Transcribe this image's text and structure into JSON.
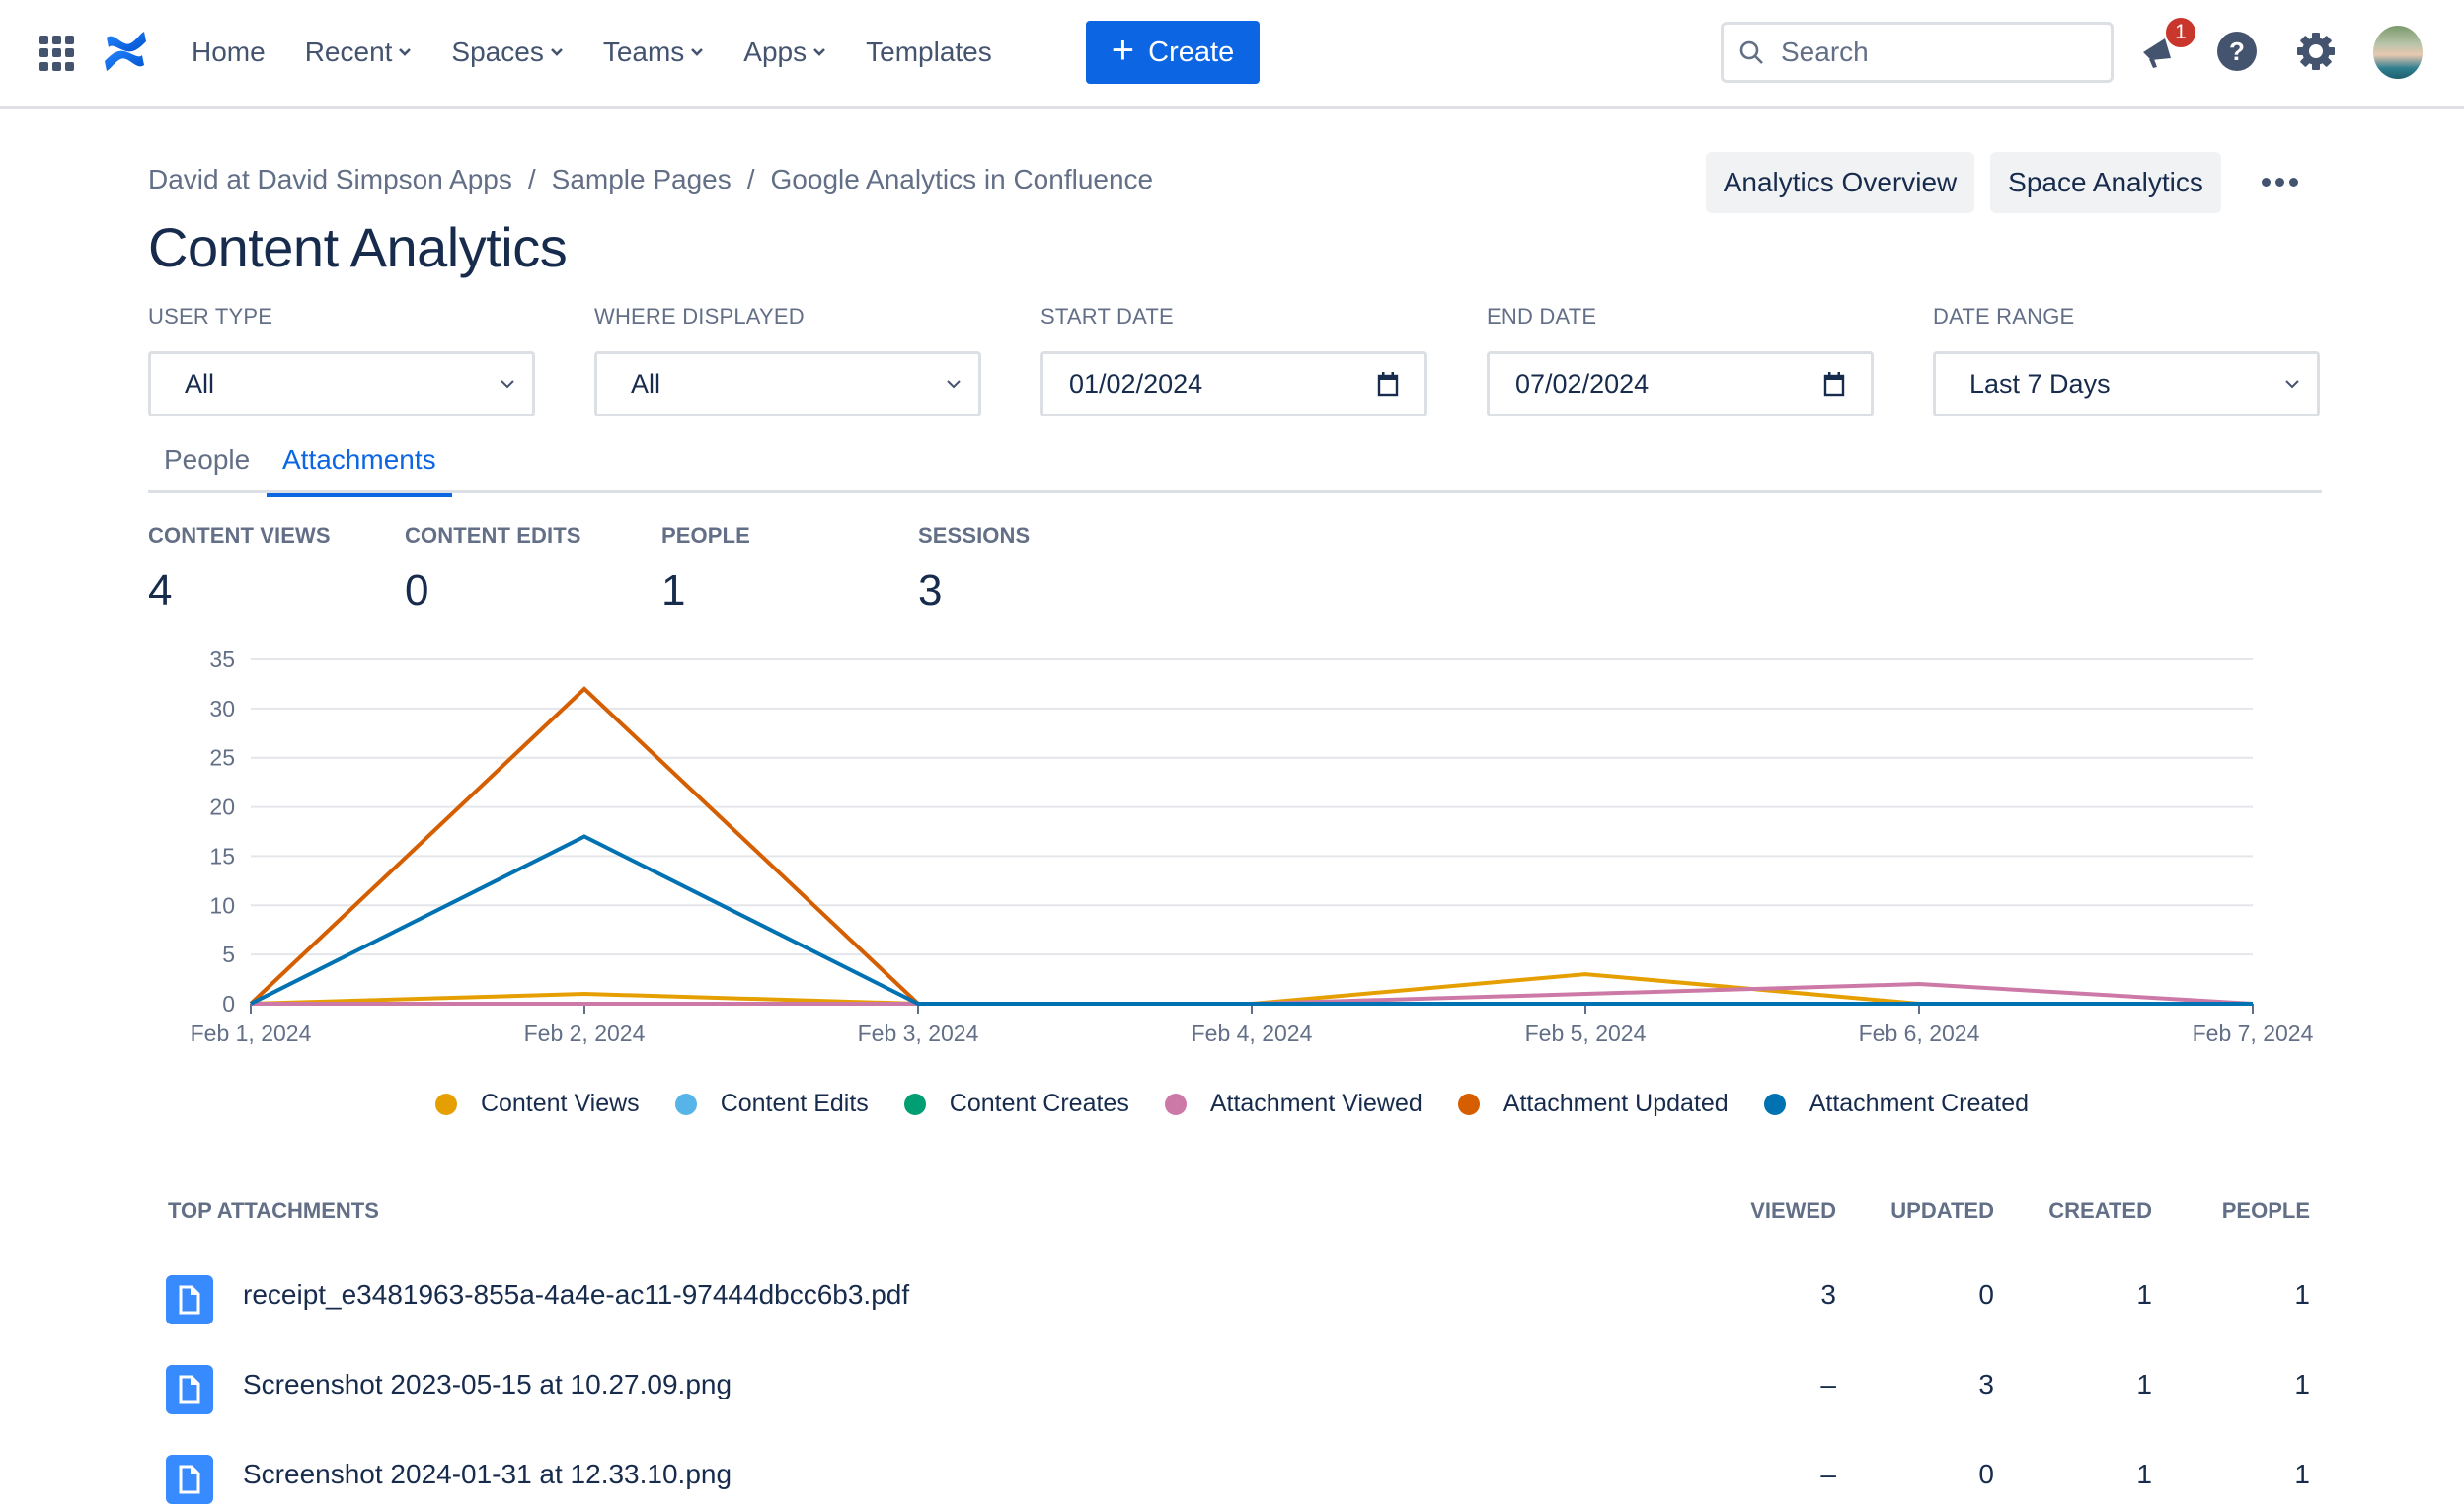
{
  "nav": {
    "items": [
      {
        "label": "Home",
        "dropdown": false
      },
      {
        "label": "Recent",
        "dropdown": true
      },
      {
        "label": "Spaces",
        "dropdown": true
      },
      {
        "label": "Teams",
        "dropdown": true
      },
      {
        "label": "Apps",
        "dropdown": true
      },
      {
        "label": "Templates",
        "dropdown": false
      }
    ],
    "create_label": "Create",
    "search_placeholder": "Search",
    "notification_count": "1",
    "brand_color": "#0c66e4"
  },
  "breadcrumb": [
    "David at David Simpson Apps",
    "Sample Pages",
    "Google Analytics in Confluence"
  ],
  "breadcrumb_separator": "/",
  "page_title": "Content Analytics",
  "header_buttons": {
    "analytics_overview": "Analytics Overview",
    "space_analytics": "Space Analytics"
  },
  "filters": {
    "user_type": {
      "label": "USER TYPE",
      "value": "All"
    },
    "where_displayed": {
      "label": "WHERE DISPLAYED",
      "value": "All"
    },
    "start_date": {
      "label": "START DATE",
      "value": "01/02/2024"
    },
    "end_date": {
      "label": "END DATE",
      "value": "07/02/2024"
    },
    "date_range": {
      "label": "DATE RANGE",
      "value": "Last 7 Days"
    }
  },
  "tabs": [
    {
      "label": "People",
      "active": false
    },
    {
      "label": "Attachments",
      "active": true
    }
  ],
  "stats": [
    {
      "label": "CONTENT VIEWS",
      "value": "4"
    },
    {
      "label": "CONTENT EDITS",
      "value": "0"
    },
    {
      "label": "PEOPLE",
      "value": "1"
    },
    {
      "label": "SESSIONS",
      "value": "3"
    }
  ],
  "chart_data": {
    "type": "line",
    "title": "",
    "xlabel": "",
    "ylabel": "",
    "x": [
      "Feb 1, 2024",
      "Feb 2, 2024",
      "Feb 3, 2024",
      "Feb 4, 2024",
      "Feb 5, 2024",
      "Feb 6, 2024",
      "Feb 7, 2024"
    ],
    "ylim": [
      0,
      35
    ],
    "yticks": [
      0,
      5,
      10,
      15,
      20,
      25,
      30,
      35
    ],
    "grid": true,
    "legend_position": "bottom",
    "series": [
      {
        "name": "Content Views",
        "color": "#e69f00",
        "values": [
          0,
          1,
          0,
          0,
          3,
          0,
          0
        ]
      },
      {
        "name": "Content Edits",
        "color": "#56b4e9",
        "values": [
          0,
          0,
          0,
          0,
          0,
          0,
          0
        ]
      },
      {
        "name": "Content Creates",
        "color": "#009e73",
        "values": [
          0,
          0,
          0,
          0,
          0,
          0,
          0
        ]
      },
      {
        "name": "Attachment Viewed",
        "color": "#cc79a7",
        "values": [
          0,
          0,
          0,
          0,
          1,
          2,
          0
        ]
      },
      {
        "name": "Attachment Updated",
        "color": "#d55e00",
        "values": [
          0,
          32,
          0,
          0,
          0,
          0,
          0
        ]
      },
      {
        "name": "Attachment Created",
        "color": "#0072b2",
        "values": [
          0,
          17,
          0,
          0,
          0,
          0,
          0
        ]
      }
    ]
  },
  "top_attachments": {
    "title": "TOP ATTACHMENTS",
    "columns": [
      "VIEWED",
      "UPDATED",
      "CREATED",
      "PEOPLE"
    ],
    "rows": [
      {
        "name": "receipt_e3481963-855a-4a4e-ac11-97444dbcc6b3.pdf",
        "viewed": "3",
        "updated": "0",
        "created": "1",
        "people": "1"
      },
      {
        "name": "Screenshot 2023-05-15 at 10.27.09.png",
        "viewed": "–",
        "updated": "3",
        "created": "1",
        "people": "1"
      },
      {
        "name": "Screenshot 2024-01-31 at 12.33.10.png",
        "viewed": "–",
        "updated": "0",
        "created": "1",
        "people": "1"
      }
    ]
  }
}
